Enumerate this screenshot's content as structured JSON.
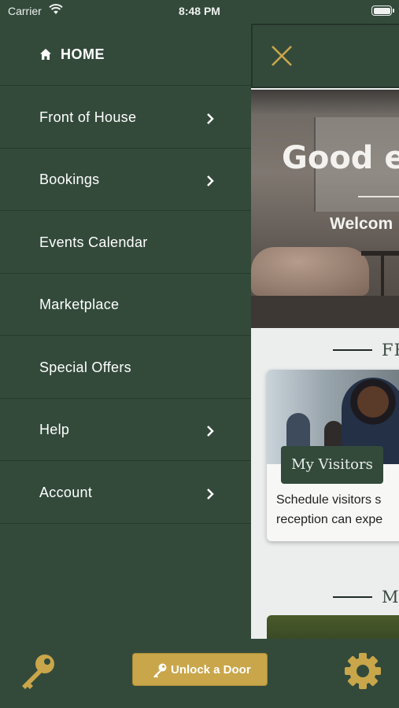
{
  "status_bar": {
    "carrier": "Carrier",
    "time": "8:48 PM"
  },
  "menu": {
    "home_label": "HOME",
    "items": [
      {
        "label": "Front of House",
        "has_chevron": true
      },
      {
        "label": "Bookings",
        "has_chevron": true
      },
      {
        "label": "Events Calendar",
        "has_chevron": false
      },
      {
        "label": "Marketplace",
        "has_chevron": false
      },
      {
        "label": "Special Offers",
        "has_chevron": false
      },
      {
        "label": "Help",
        "has_chevron": true
      },
      {
        "label": "Account",
        "has_chevron": true
      }
    ]
  },
  "main": {
    "hero_title": "Good e",
    "hero_subtitle": "Welcom",
    "section1_heading": "FR",
    "card_badge": "My Visitors",
    "card_text": "Schedule visitors s\nreception can expe",
    "section2_heading": "M"
  },
  "bottom_bar": {
    "unlock_label": "Unlock a Door"
  },
  "colors": {
    "primary_green": "#334a3b",
    "accent_gold": "#c9a64a",
    "divider": "#273a2d",
    "content_bg": "#eceeed"
  },
  "icons": [
    "wifi-icon",
    "battery-icon",
    "home-icon",
    "chevron-right-icon",
    "close-icon",
    "key-icon",
    "gear-icon"
  ]
}
